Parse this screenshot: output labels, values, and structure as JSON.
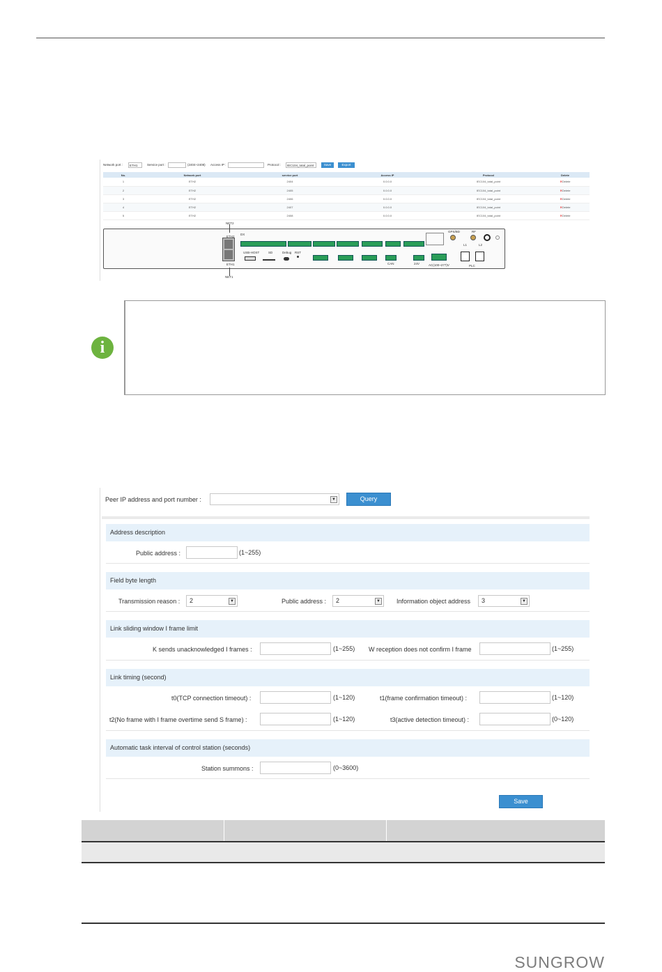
{
  "shot1": {
    "toolbar": {
      "network_port_label": "Network port :",
      "network_port_value": "ETH1",
      "service_port_label": "Service port :",
      "service_port_range": "(2404~2408)",
      "access_ip_label": "Access IP :",
      "protocol_label": "Protocol :",
      "protocol_value": "IEC104_total_point",
      "save": "Save",
      "export": "Export"
    },
    "columns": [
      "No.",
      "Network port",
      "service port",
      "Access IP",
      "Protocol",
      "Delete"
    ],
    "rows": [
      [
        "1",
        "ETH2",
        "2404",
        "0.0.0.0",
        "IEC104_total_point",
        "Delete"
      ],
      [
        "2",
        "ETH2",
        "2405",
        "0.0.0.0",
        "IEC104_total_point",
        "Delete"
      ],
      [
        "3",
        "ETH2",
        "2406",
        "0.0.0.0",
        "IEC104_total_point",
        "Delete"
      ],
      [
        "4",
        "ETH2",
        "2407",
        "0.0.0.0",
        "IEC104_total_point",
        "Delete"
      ],
      [
        "5",
        "ETH2",
        "2408",
        "0.0.0.0",
        "IEC104_total_point",
        "Delete"
      ]
    ],
    "device": {
      "net2": "NET2",
      "net1": "NET1",
      "eth2": "ETH2",
      "eth1": "ETH1",
      "usb": "USB-HOST",
      "sd": "SD",
      "debug": "Debug",
      "rst": "RST",
      "dx": "DX",
      "gps": "GPS/BD",
      "rf": "RF",
      "l1": "L1",
      "l2": "L2",
      "plc": "PLC",
      "can": "CAN",
      "v24": "24V",
      "ac": "AC(100~277)V"
    }
  },
  "form": {
    "peer_label": "Peer IP address and port number :",
    "query": "Query",
    "sections": {
      "address": "Address description",
      "field": "Field byte length",
      "window": "Link sliding window I frame limit",
      "timing": "Link timing (second)",
      "task": "Automatic task interval of control station (seconds)"
    },
    "public_address_label": "Public address :",
    "public_address_range": "(1~255)",
    "transmission_reason_label": "Transmission reason :",
    "transmission_reason_value": "2",
    "public_address2_label": "Public address :",
    "public_address2_value": "2",
    "info_obj_label": "Information object address",
    "info_obj_value": "3",
    "k_label": "K sends unacknowledged I frames :",
    "k_range": "(1~255)",
    "w_label": "W reception does not confirm I frame",
    "w_range": "(1~255)",
    "t0_label": "t0(TCP connection timeout) :",
    "t0_range": "(1~120)",
    "t1_label": "t1(frame confirmation timeout) :",
    "t1_range": "(1~120)",
    "t2_label": "t2(No frame with I frame overtime send S frame) :",
    "t2_range": "(1~120)",
    "t3_label": "t3(active detection timeout) :",
    "t3_range": "(0~120)",
    "station_label": "Station summons :",
    "station_range": "(0~3600)",
    "save": "Save"
  },
  "footer": {
    "logo": "SUNGROW"
  }
}
